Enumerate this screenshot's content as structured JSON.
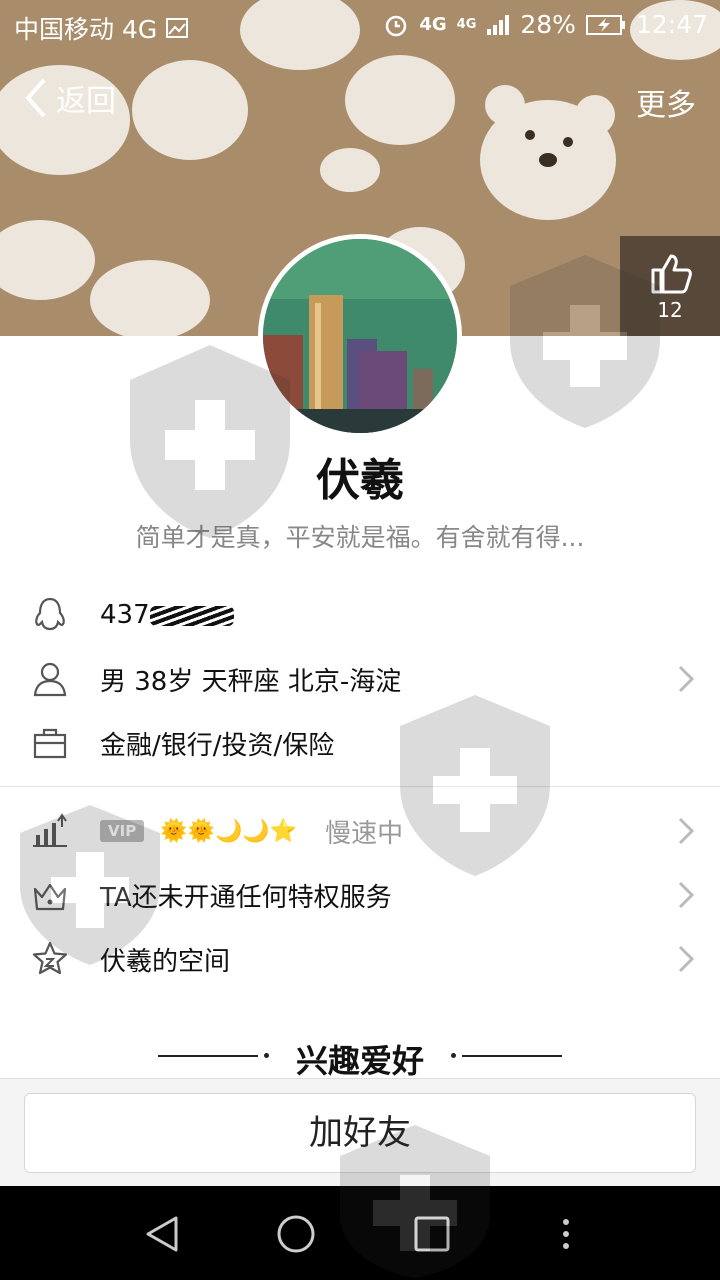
{
  "status_bar": {
    "carrier": "中国移动 4G",
    "network_1": "4G",
    "network_2": "4G",
    "battery": "28%",
    "time": "12:47"
  },
  "nav": {
    "back_label": "返回",
    "more_label": "更多"
  },
  "like": {
    "count": "12"
  },
  "profile": {
    "nickname": "伏羲",
    "signature": "简单才是真，平安就是福。有舍就有得..."
  },
  "info": {
    "qq_number": "437",
    "personal": "男  38岁  天秤座  北京-海淀",
    "occupation": "金融/银行/投资/保险"
  },
  "vip": {
    "badge": "VIP",
    "level_icons": "🌞🌞🌙🌙⭐",
    "speed_status": "慢速中"
  },
  "privilege": {
    "label": "TA还未开通任何特权服务"
  },
  "space": {
    "label": "伏羲的空间"
  },
  "section": {
    "title": "兴趣爱好"
  },
  "action": {
    "add_friend": "加好友"
  },
  "colors": {
    "header_bg": "#a98d6b",
    "avatar_sky": "#3f8a6a",
    "level_icon": "#f0a500"
  }
}
